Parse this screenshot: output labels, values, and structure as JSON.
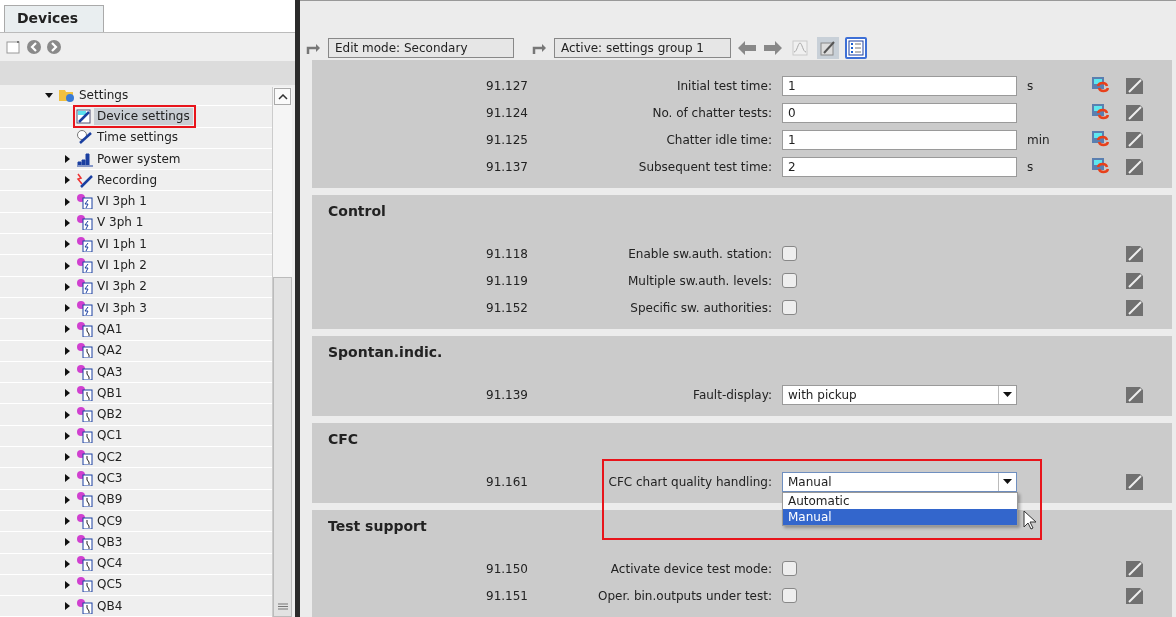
{
  "devices_panel": {
    "tab": "Devices",
    "tree": [
      {
        "label": "Settings",
        "kind": "settings",
        "expanded": true,
        "selected": false,
        "highlighted": false,
        "children": [
          {
            "label": "Device settings",
            "kind": "device",
            "selected": true,
            "highlighted": true
          },
          {
            "label": "Time settings",
            "kind": "time",
            "selected": false,
            "highlighted": false
          },
          {
            "label": "Power system",
            "kind": "power",
            "expanded": false,
            "selected": false,
            "highlighted": false
          },
          {
            "label": "Recording",
            "kind": "recording",
            "expanded": false,
            "selected": false,
            "highlighted": false
          },
          {
            "label": "VI 3ph 1",
            "kind": "function",
            "expanded": false,
            "selected": false,
            "highlighted": false
          },
          {
            "label": "V 3ph 1",
            "kind": "function",
            "expanded": false,
            "selected": false,
            "highlighted": false
          },
          {
            "label": "VI 1ph 1",
            "kind": "function",
            "expanded": false,
            "selected": false,
            "highlighted": false
          },
          {
            "label": "VI 1ph 2",
            "kind": "function",
            "expanded": false,
            "selected": false,
            "highlighted": false
          },
          {
            "label": "VI 3ph 2",
            "kind": "function",
            "expanded": false,
            "selected": false,
            "highlighted": false
          },
          {
            "label": "VI 3ph 3",
            "kind": "function",
            "expanded": false,
            "selected": false,
            "highlighted": false
          },
          {
            "label": "QA1",
            "kind": "switch",
            "expanded": false,
            "selected": false,
            "highlighted": false
          },
          {
            "label": "QA2",
            "kind": "switch",
            "expanded": false,
            "selected": false,
            "highlighted": false
          },
          {
            "label": "QA3",
            "kind": "switch",
            "expanded": false,
            "selected": false,
            "highlighted": false
          },
          {
            "label": "QB1",
            "kind": "switch",
            "expanded": false,
            "selected": false,
            "highlighted": false
          },
          {
            "label": "QB2",
            "kind": "switch",
            "expanded": false,
            "selected": false,
            "highlighted": false
          },
          {
            "label": "QC1",
            "kind": "switch",
            "expanded": false,
            "selected": false,
            "highlighted": false
          },
          {
            "label": "QC2",
            "kind": "switch",
            "expanded": false,
            "selected": false,
            "highlighted": false
          },
          {
            "label": "QC3",
            "kind": "switch",
            "expanded": false,
            "selected": false,
            "highlighted": false
          },
          {
            "label": "QB9",
            "kind": "switch",
            "expanded": false,
            "selected": false,
            "highlighted": false
          },
          {
            "label": "QC9",
            "kind": "switch",
            "expanded": false,
            "selected": false,
            "highlighted": false
          },
          {
            "label": "QB3",
            "kind": "switch",
            "expanded": false,
            "selected": false,
            "highlighted": false
          },
          {
            "label": "QC4",
            "kind": "switch",
            "expanded": false,
            "selected": false,
            "highlighted": false
          },
          {
            "label": "QC5",
            "kind": "switch",
            "expanded": false,
            "selected": false,
            "highlighted": false
          },
          {
            "label": "QB4",
            "kind": "switch",
            "expanded": false,
            "selected": false,
            "highlighted": false
          }
        ]
      }
    ]
  },
  "toolbar": {
    "edit_mode": "Edit mode:  Secondary",
    "active_group": "Active:  settings group 1",
    "view_buttons": [
      {
        "kind": "chart",
        "disabled": true,
        "pressed": false,
        "selected": false
      },
      {
        "kind": "edit",
        "disabled": false,
        "pressed": true,
        "selected": false
      },
      {
        "kind": "list",
        "disabled": false,
        "pressed": false,
        "selected": true
      }
    ]
  },
  "sections": [
    {
      "rows": [
        {
          "number": "91.127",
          "label": "Initial test time:",
          "kind": "text",
          "value": "1",
          "unit": "s",
          "sync": true,
          "highlighted": false
        },
        {
          "number": "91.124",
          "label": "No. of chatter tests:",
          "kind": "text",
          "value": "0",
          "sync": true,
          "highlighted": false
        },
        {
          "number": "91.125",
          "label": "Chatter idle time:",
          "kind": "text",
          "value": "1",
          "unit": "min",
          "sync": true,
          "highlighted": false
        },
        {
          "number": "91.137",
          "label": "Subsequent test time:",
          "kind": "text",
          "value": "2",
          "unit": "s",
          "sync": true,
          "highlighted": false
        }
      ]
    },
    {
      "title": "Control",
      "rows": [
        {
          "number": "91.118",
          "label": "Enable sw.auth. station:",
          "kind": "checkbox",
          "checked": false,
          "sync": false,
          "highlighted": false
        },
        {
          "number": "91.119",
          "label": "Multiple sw.auth. levels:",
          "kind": "checkbox",
          "checked": false,
          "sync": false,
          "highlighted": false
        },
        {
          "number": "91.152",
          "label": "Specific sw. authorities:",
          "kind": "checkbox",
          "checked": false,
          "sync": false,
          "highlighted": false
        }
      ]
    },
    {
      "title": "Spontan.indic.",
      "rows": [
        {
          "number": "91.139",
          "label": "Fault-display:",
          "kind": "select",
          "value": "with pickup",
          "expanded": false,
          "sync": false,
          "highlighted": false
        }
      ]
    },
    {
      "title": "CFC",
      "rows": [
        {
          "number": "91.161",
          "label": "CFC chart quality handling:",
          "kind": "select",
          "value": "Manual",
          "expanded": true,
          "sync": false,
          "highlighted": true,
          "options": [
            {
              "label": "Automatic",
              "selected": false
            },
            {
              "label": "Manual",
              "selected": true
            }
          ]
        }
      ]
    },
    {
      "title": "Test support",
      "rows": [
        {
          "number": "91.150",
          "label": "Activate device test mode:",
          "kind": "checkbox",
          "checked": false,
          "sync": false,
          "highlighted": false
        },
        {
          "number": "91.151",
          "label": "Oper. bin.outputs under test:",
          "kind": "checkbox",
          "checked": false,
          "sync": false,
          "highlighted": false
        }
      ]
    }
  ]
}
